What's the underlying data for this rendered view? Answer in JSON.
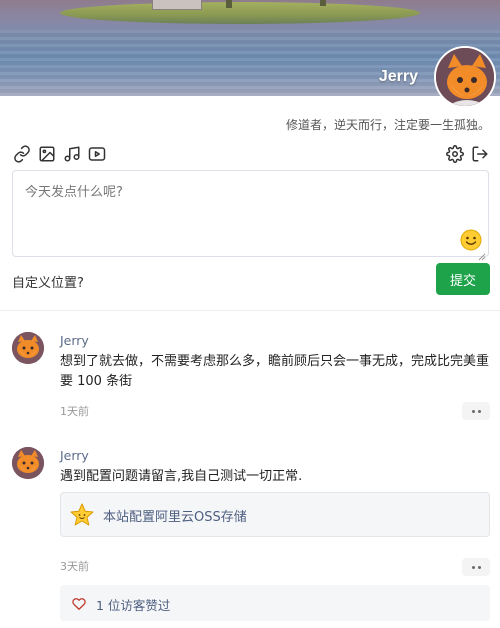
{
  "profile": {
    "name": "Jerry",
    "motto": "修道者，逆天而行，注定要一生孤独。"
  },
  "toolbar": {
    "left_icons": [
      "link-icon",
      "image-icon",
      "music-icon",
      "video-icon"
    ],
    "right_icons": [
      "gear-icon",
      "logout-icon"
    ]
  },
  "composer": {
    "placeholder": "今天发点什么呢?",
    "location_link": "自定义位置?",
    "submit_label": "提交"
  },
  "posts": [
    {
      "author": "Jerry",
      "text": "想到了就去做，不需要考虑那么多，瞻前顾后只会一事无成，完成比完美重要 100 条街",
      "time": "1天前"
    },
    {
      "author": "Jerry",
      "text": "遇到配置问题请留言,我自己测试一切正常.",
      "link_title": "本站配置阿里云OSS存储",
      "time": "3天前",
      "likes": "1 位访客赞过"
    }
  ],
  "colors": {
    "accent_green": "#1ea34a",
    "author_blue": "#5c6b8a"
  }
}
